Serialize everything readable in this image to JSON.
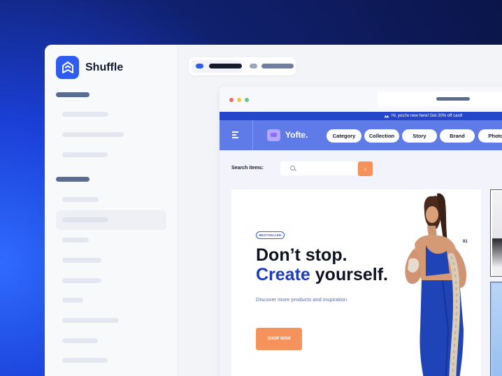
{
  "app": {
    "name": "Shuffle",
    "logo_icon": "shuffle-logo-icon"
  },
  "browser_preview": {
    "promo_text": "Hi, you're new here! Get 20% off card!",
    "brand": "Yofte.",
    "nav_items": [
      "Category",
      "Collection",
      "Story",
      "Brand",
      "Photo"
    ],
    "search_label": "Search items:",
    "search_button_icon": "arrow-right-icon",
    "hero": {
      "badge": "BESTSELLER",
      "headline_line1": "Don’t stop.",
      "headline_accent": "Create",
      "headline_rest": "yourself.",
      "subtext": "Discover more products and inspiration.",
      "cta": "SHOP NOW",
      "slide_number": "01"
    }
  },
  "colors": {
    "accent": "#2f5cf0",
    "nav": "#5e7be8",
    "promo": "#2546c9",
    "cta": "#f6935c",
    "headline_accent": "#1d3cbe"
  }
}
